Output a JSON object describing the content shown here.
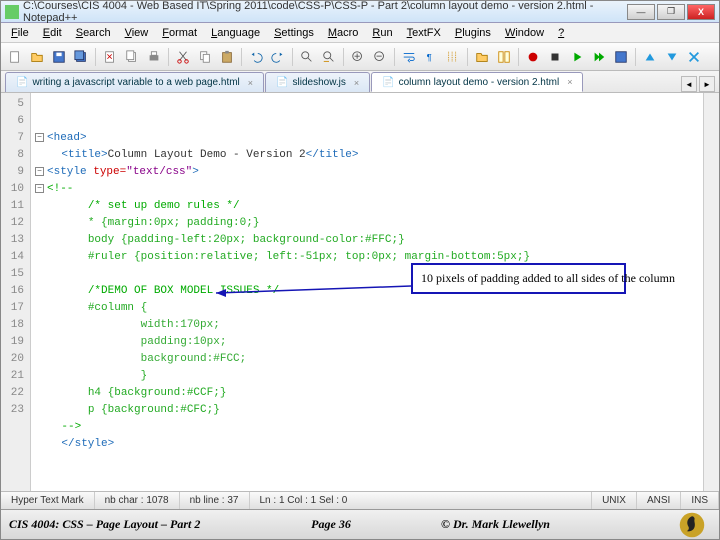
{
  "titlebar": {
    "path": "C:\\Courses\\CIS 4004 - Web Based IT\\Spring 2011\\code\\CSS-P\\CSS-P - Part 2\\column layout demo - version 2.html - Notepad++"
  },
  "menu": [
    "File",
    "Edit",
    "Search",
    "View",
    "Format",
    "Language",
    "Settings",
    "Macro",
    "Run",
    "TextFX",
    "Plugins",
    "Window",
    "?"
  ],
  "tabs": [
    {
      "label": "writing a javascript variable to a web page.html",
      "active": false
    },
    {
      "label": "slideshow.js",
      "active": false
    },
    {
      "label": "column layout demo - version 2.html",
      "active": true
    }
  ],
  "gutter_start": 5,
  "code": [
    {
      "fold": "minus",
      "html": "<span class='tag'>&lt;head&gt;</span>"
    },
    {
      "indent": 1,
      "html": "<span class='tag'>&lt;title&gt;</span>Column Layout Demo - Version 2<span class='tag'>&lt;/title&gt;</span>"
    },
    {
      "fold": "minus",
      "html": "<span class='tag'>&lt;style</span> <span class='attr'>type=</span><span class='str'>\"text/css\"</span><span class='tag'>&gt;</span>"
    },
    {
      "fold": "minus",
      "html": "<span class='comm'>&lt;!--</span>"
    },
    {
      "indent": 2,
      "html": "<span class='comm'>/* set up demo rules */</span>"
    },
    {
      "indent": 2,
      "html": "<span class='csssel'>* {margin:0px; padding:0;}</span>"
    },
    {
      "indent": 2,
      "html": "<span class='csssel'>body {padding-left:20px; background-color:#FFC;}</span>"
    },
    {
      "indent": 2,
      "html": "<span class='csssel'>#ruler {position:relative; left:-51px; top:0px; margin-bottom:5px;}</span>"
    },
    {
      "indent": 2,
      "html": ""
    },
    {
      "indent": 2,
      "html": "<span class='comm'>/*DEMO OF BOX MODEL ISSUES */</span>"
    },
    {
      "indent": 2,
      "html": "<span class='csssel'>#column {</span>"
    },
    {
      "indent": 4,
      "html": "<span class='cssprop'>width:170px;</span>"
    },
    {
      "indent": 4,
      "html": "<span class='cssprop'>padding:10px;</span>"
    },
    {
      "indent": 4,
      "html": "<span class='cssprop'>background:#FCC;</span>"
    },
    {
      "indent": 4,
      "html": "<span class='csssel'>}</span>"
    },
    {
      "indent": 2,
      "html": "<span class='csssel'>h4 {background:#CCF;}</span>"
    },
    {
      "indent": 2,
      "html": "<span class='csssel'>p {background:#CFC;}</span>"
    },
    {
      "indent": 1,
      "html": "<span class='comm'>--&gt;</span>"
    },
    {
      "indent": 1,
      "html": "<span class='tag'>&lt;/style&gt;</span>"
    }
  ],
  "callout": "10 pixels of padding added to all sides of the column",
  "status": {
    "lang": "Hyper Text Mark",
    "nbchar": "nb char : 1078",
    "nbline": "nb line : 37",
    "pos": "Ln : 1   Col : 1   Sel : 0",
    "eol": "UNIX",
    "enc": "ANSI",
    "mode": "INS"
  },
  "footer": {
    "course": "CIS 4004: CSS – Page Layout – Part 2",
    "page": "Page 36",
    "author": "© Dr. Mark Llewellyn"
  }
}
